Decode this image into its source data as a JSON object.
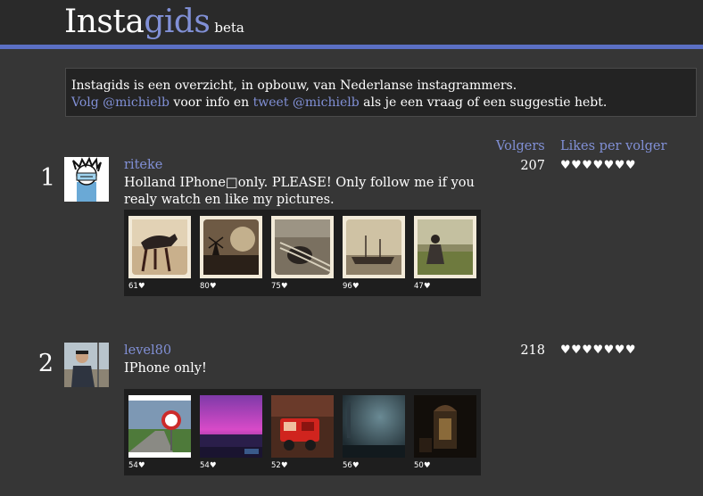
{
  "header": {
    "logo_part1": "Insta",
    "logo_part2": "gids",
    "logo_badge": "beta"
  },
  "intro": {
    "line1": "Instagids is een overzicht, in opbouw, van Nederlanse instagrammers.",
    "follow_link": "Volg @michielb",
    "text_mid": " voor info en ",
    "tweet_link": "tweet @michielb",
    "text_end": " als je een vraag of een suggestie hebt."
  },
  "columns": {
    "followers": "Volgers",
    "likes_per_follower": "Likes per volger"
  },
  "users": [
    {
      "rank": "1",
      "username": "riteke",
      "bio_line1": "Holland IPhone□only. PLEASE! Only follow me if you",
      "bio_line2": "realy watch en like my pictures.",
      "followers": "207",
      "hearts": "♥♥♥♥♥♥♥",
      "photos": [
        {
          "likes": "61",
          "heart": "♥"
        },
        {
          "likes": "80",
          "heart": "♥"
        },
        {
          "likes": "75",
          "heart": "♥"
        },
        {
          "likes": "96",
          "heart": "♥"
        },
        {
          "likes": "47",
          "heart": "♥"
        }
      ]
    },
    {
      "rank": "2",
      "username": "level80",
      "bio_line1": "IPhone only!",
      "followers": "218",
      "hearts": "♥♥♥♥♥♥♥",
      "photos": [
        {
          "likes": "54",
          "heart": "♥"
        },
        {
          "likes": "54",
          "heart": "♥"
        },
        {
          "likes": "52",
          "heart": "♥"
        },
        {
          "likes": "56",
          "heart": "♥"
        },
        {
          "likes": "50",
          "heart": "♥"
        }
      ]
    }
  ]
}
